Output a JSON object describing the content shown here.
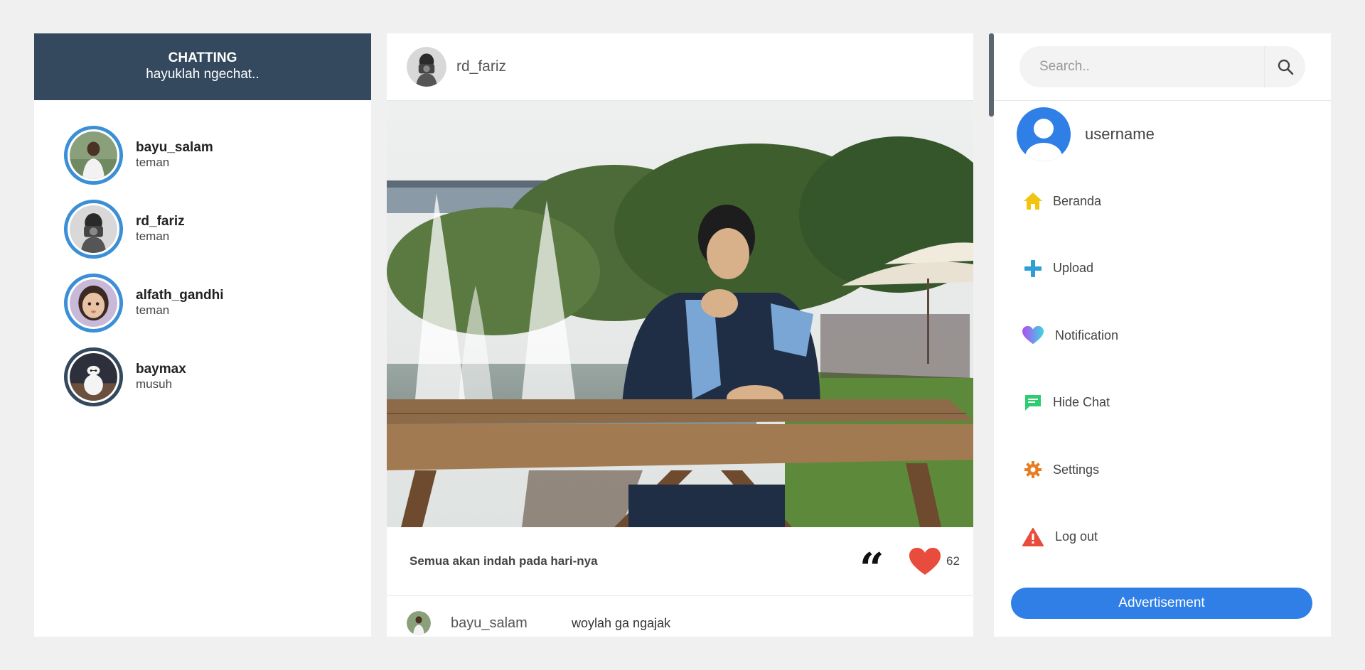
{
  "chat": {
    "title": "CHATTING",
    "subtitle": "hayuklah ngechat..",
    "friends": [
      {
        "name": "bayu_salam",
        "status": "teman"
      },
      {
        "name": "rd_fariz",
        "status": "teman"
      },
      {
        "name": "alfath_gandhi",
        "status": "teman"
      },
      {
        "name": "baymax",
        "status": "musuh"
      }
    ]
  },
  "post": {
    "author": "rd_fariz",
    "caption": "Semua akan indah pada hari-nya",
    "quote_glyph": "“",
    "likes": "62",
    "comments": [
      {
        "user": "bayu_salam",
        "text": "woylah ga ngajak"
      }
    ]
  },
  "search": {
    "placeholder": "Search.."
  },
  "profile": {
    "username": "username"
  },
  "menu": [
    {
      "label": "Beranda",
      "icon": "home-icon",
      "color": "#f1c40f"
    },
    {
      "label": "Upload",
      "icon": "plus-icon",
      "color": "#2e9fd6"
    },
    {
      "label": "Notification",
      "icon": "heart-icon",
      "color": "#a855f7"
    },
    {
      "label": "Hide Chat",
      "icon": "chat-icon",
      "color": "#2ecc71"
    },
    {
      "label": "Settings",
      "icon": "gear-icon",
      "color": "#e67e22"
    },
    {
      "label": "Log out",
      "icon": "warning-icon",
      "color": "#e74c3c"
    }
  ],
  "ad_label": "Advertisement",
  "colors": {
    "header": "#34495e",
    "accent": "#2f7fe6",
    "ring": "#3a8fd6",
    "like": "#e74c3c"
  }
}
